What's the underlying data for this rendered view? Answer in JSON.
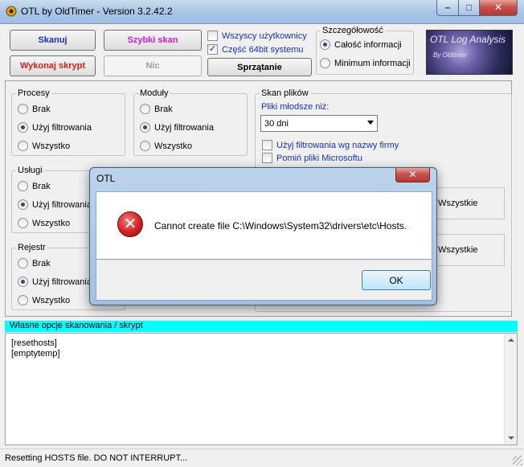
{
  "window": {
    "title": "OTL by OldTimer - Version 3.2.42.2",
    "min_glyph": "–",
    "max_glyph": "□",
    "close_glyph": "✕"
  },
  "toolbar": {
    "scan_label": "Skanuj",
    "quick_scan_label": "Szybki skan",
    "run_script_label": "Wykonaj skrypt",
    "nothing_label": "Nic",
    "cleanup_label": "Sprzątanie",
    "all_users_label": "Wszyscy użytkownicy",
    "part_64bit_label": "Część 64bit systemu",
    "part_64bit_checked": "✓"
  },
  "detail": {
    "legend": "Szczegółowość",
    "full_label": "Całość informacji",
    "min_label": "Minimum informacji"
  },
  "logo": {
    "title": "OTL Log Analysis",
    "subtitle": "By Oldtimer"
  },
  "processes": {
    "legend": "Procesy",
    "none": "Brak",
    "filtered": "Użyj filtrowania",
    "all": "Wszystko"
  },
  "modules": {
    "legend": "Moduły",
    "none": "Brak",
    "filtered": "Użyj filtrowania",
    "all": "Wszystko"
  },
  "services": {
    "legend": "Usługi",
    "none": "Brak",
    "filtered": "Użyj filtrowania",
    "all": "Wszystko"
  },
  "registry": {
    "legend": "Rejestr",
    "none": "Brak",
    "filtered": "Użyj filtrowania",
    "all": "Wszystko"
  },
  "file_scan": {
    "legend": "Skan plików",
    "younger_label": "Pliki młodsze niż:",
    "younger_value": "30 dni",
    "filter_company_label": "Użyj filtrowania wg nazwy firmy",
    "skip_ms_label": "Pomiń pliki Microsoftu",
    "all_label_1": "Wszystkie",
    "all_label_2": "Wszystkie"
  },
  "script": {
    "header": "Własne opcje skanowania / skrypt",
    "lines": [
      "[resethosts]",
      "[emptytemp]"
    ]
  },
  "status": {
    "text": "Resetting HOSTS file. DO NOT INTERRUPT..."
  },
  "dialog": {
    "title": "OTL",
    "message": "Cannot create file C:\\Windows\\System32\\drivers\\etc\\Hosts.",
    "ok_label": "OK",
    "close_glyph": "✕",
    "error_glyph": "✕"
  }
}
